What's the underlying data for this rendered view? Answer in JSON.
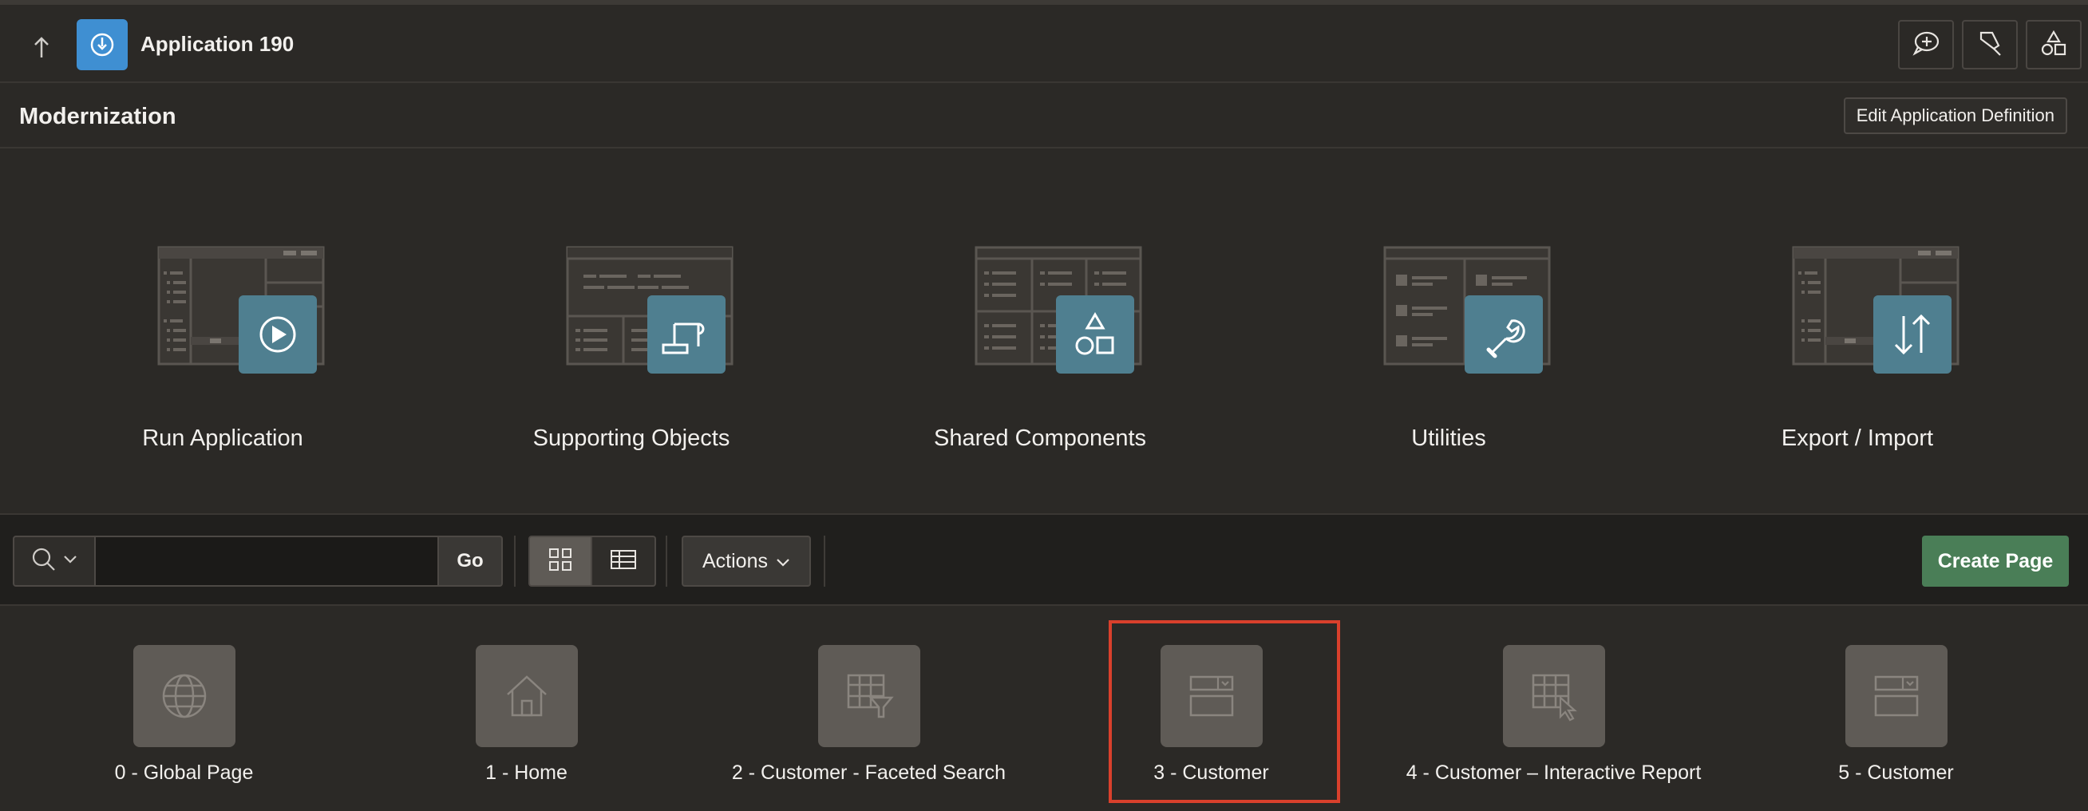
{
  "header": {
    "app_title": "Application 190",
    "icons": [
      "arrow-up-icon",
      "app-icon",
      "feedback-icon",
      "sql-workshop-icon",
      "shapes-icon"
    ]
  },
  "section": {
    "title": "Modernization",
    "edit_button": "Edit Application Definition"
  },
  "tiles": [
    {
      "label": "Run Application",
      "icon": "play-icon"
    },
    {
      "label": "Supporting Objects",
      "icon": "scroll-icon"
    },
    {
      "label": "Shared Components",
      "icon": "shapes-icon"
    },
    {
      "label": "Utilities",
      "icon": "wrench-icon"
    },
    {
      "label": "Export / Import",
      "icon": "arrows-up-down-icon"
    }
  ],
  "toolbar": {
    "search_value": "",
    "go_label": "Go",
    "actions_label": "Actions",
    "create_label": "Create Page"
  },
  "pages": [
    {
      "label": "0 - Global Page",
      "icon": "globe-icon"
    },
    {
      "label": "1 - Home",
      "icon": "home-icon"
    },
    {
      "label": "2 - Customer - Faceted Search",
      "icon": "faceted-search-icon"
    },
    {
      "label": "3 - Customer",
      "icon": "form-icon",
      "selected": true
    },
    {
      "label": "4 - Customer – Interactive Report",
      "icon": "interactive-report-icon"
    },
    {
      "label": "5 - Customer",
      "icon": "form-icon"
    }
  ],
  "colors": {
    "background": "#2b2926",
    "accent_blue": "#3f8fd2",
    "tile_badge": "#4f7f90",
    "create_green": "#4a7e57",
    "highlight_red": "#d9402c"
  }
}
